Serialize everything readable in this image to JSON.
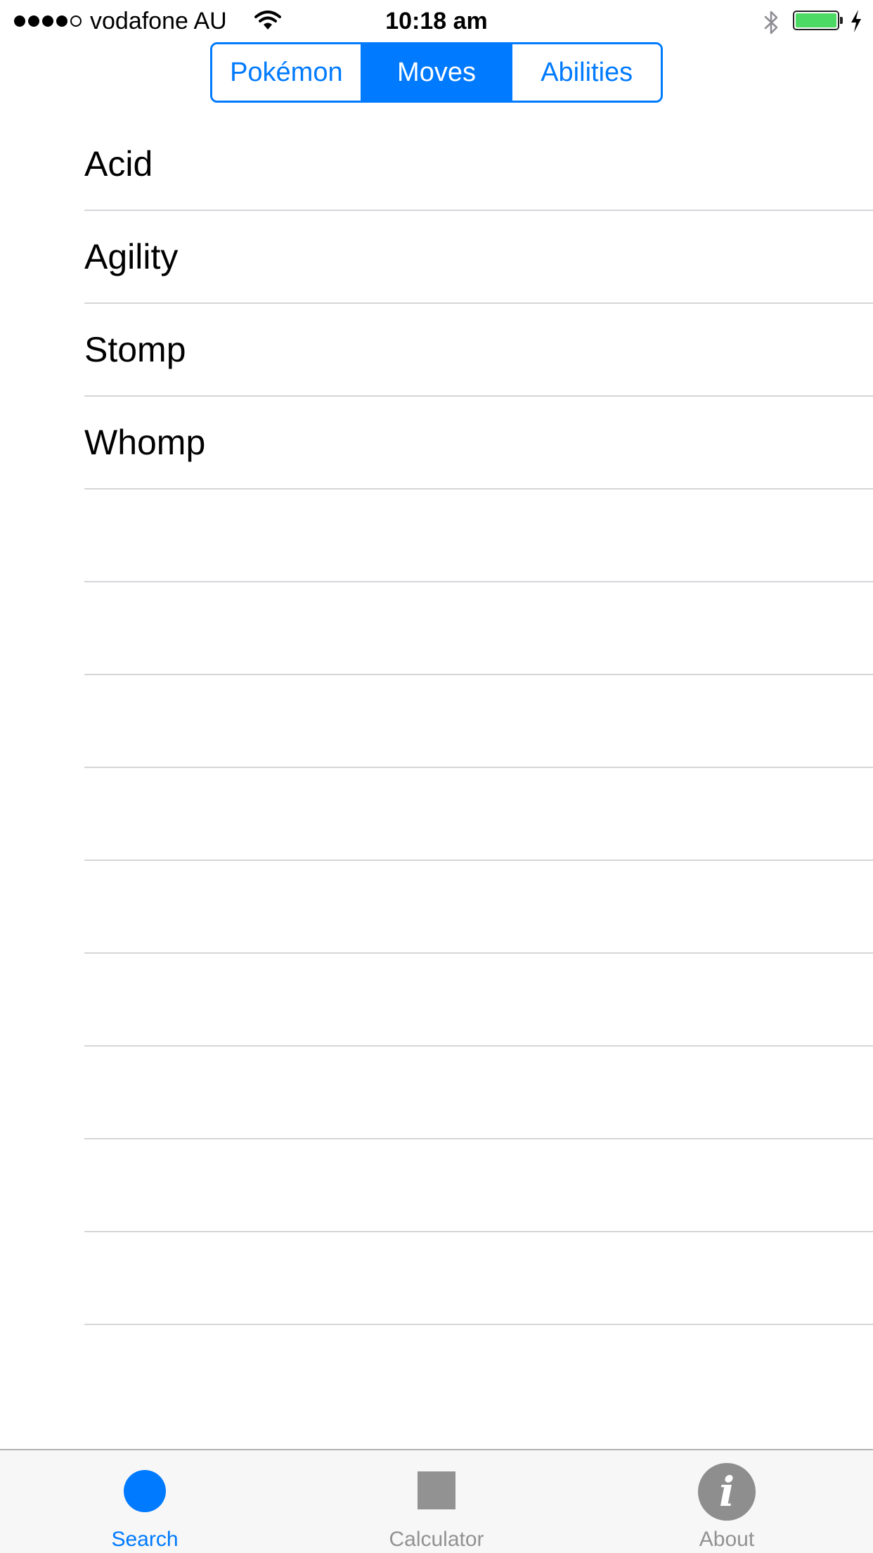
{
  "status_bar": {
    "carrier": "vodafone AU",
    "time": "10:18 am",
    "signal_bars_filled": 4,
    "signal_bars_total": 5,
    "battery_level": 1.0,
    "battery_color": "#4cd964",
    "charging": true,
    "icons": [
      "wifi-icon",
      "bluetooth-icon",
      "battery-icon",
      "charging-bolt-icon"
    ]
  },
  "segmented_control": {
    "segments": [
      {
        "label": "Pokémon",
        "selected": false
      },
      {
        "label": "Moves",
        "selected": true
      },
      {
        "label": "Abilities",
        "selected": false
      }
    ],
    "accent_color": "#007aff"
  },
  "list": {
    "items": [
      {
        "label": "Acid"
      },
      {
        "label": "Agility"
      },
      {
        "label": "Stomp"
      },
      {
        "label": "Whomp"
      },
      {
        "label": ""
      },
      {
        "label": ""
      },
      {
        "label": ""
      },
      {
        "label": ""
      },
      {
        "label": ""
      },
      {
        "label": ""
      },
      {
        "label": ""
      },
      {
        "label": ""
      },
      {
        "label": ""
      }
    ]
  },
  "tab_bar": {
    "tabs": [
      {
        "label": "Search",
        "icon": "circle-icon",
        "active": true
      },
      {
        "label": "Calculator",
        "icon": "square-icon",
        "active": false
      },
      {
        "label": "About",
        "icon": "info-icon",
        "active": false
      }
    ],
    "info_glyph": "i",
    "active_color": "#007aff",
    "inactive_color": "#929292"
  }
}
